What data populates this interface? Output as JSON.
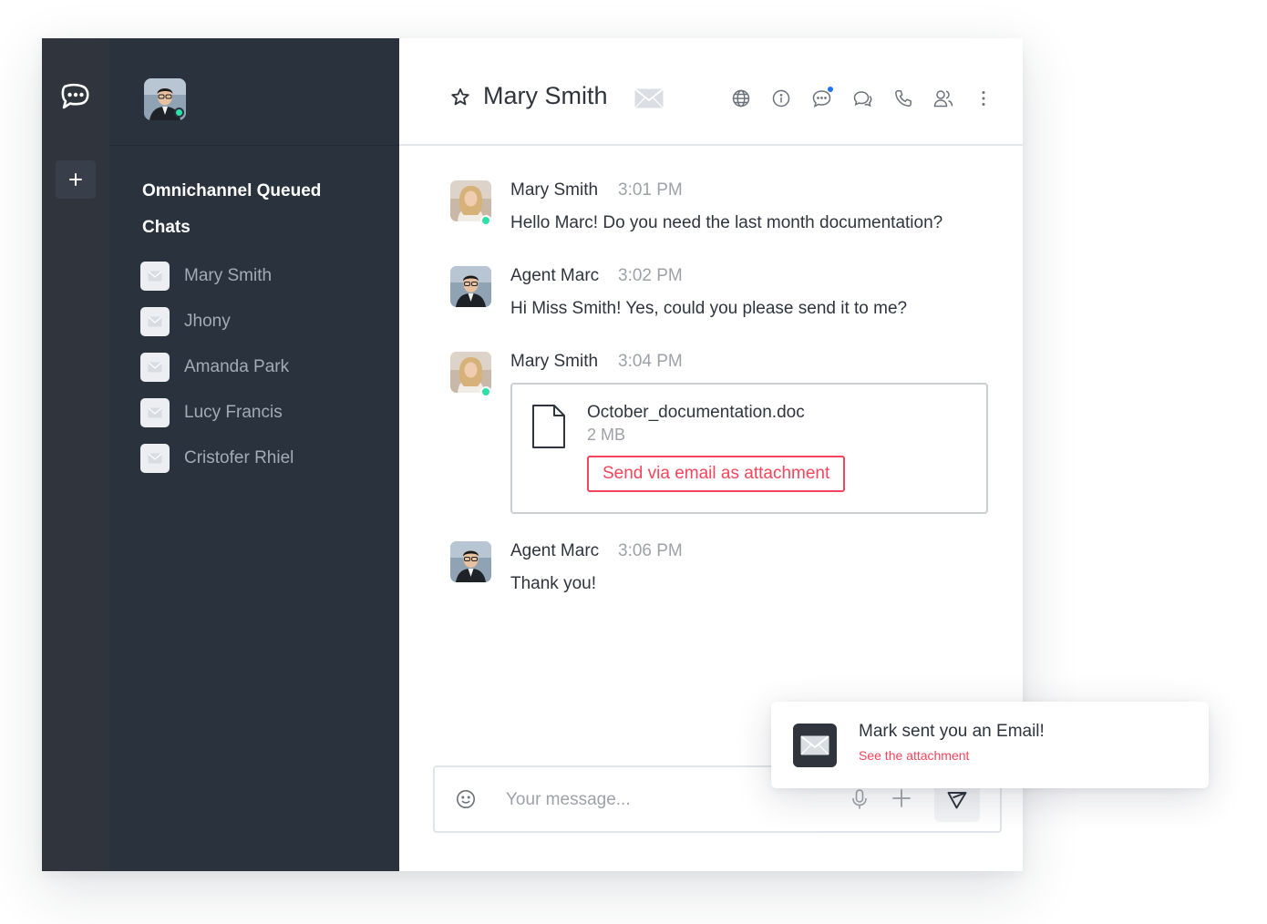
{
  "sidebar": {
    "section_title": "Omnichannel Queued Chats",
    "rooms": [
      {
        "label": "Mary Smith",
        "icon": "envelope-icon"
      },
      {
        "label": "Jhony",
        "icon": "envelope-icon"
      },
      {
        "label": "Amanda Park",
        "icon": "envelope-icon"
      },
      {
        "label": "Lucy Francis",
        "icon": "envelope-icon"
      },
      {
        "label": "Cristofer Rhiel",
        "icon": "envelope-icon"
      }
    ]
  },
  "header": {
    "title": "Mary Smith",
    "icons": [
      "star-icon",
      "envelope-icon",
      "globe-icon",
      "info-icon",
      "discussion-icon",
      "threads-icon",
      "phone-icon",
      "members-icon",
      "kebab-icon"
    ]
  },
  "messages": [
    {
      "author": "Mary Smith",
      "time": "3:01 PM",
      "text": "Hello Marc! Do you need the last month documentation?"
    },
    {
      "author": "Agent Marc",
      "time": "3:02 PM",
      "text": "Hi Miss Smith! Yes, could you please send it to me?"
    },
    {
      "author": "Mary Smith",
      "time": "3:04 PM",
      "attachment": {
        "name": "October_documentation.doc",
        "size": "2 MB",
        "action": "Send via email as attachment"
      }
    },
    {
      "author": "Agent Marc",
      "time": "3:06 PM",
      "text": "Thank you!"
    }
  ],
  "composer": {
    "placeholder": "Your message..."
  },
  "toast": {
    "title": "Mark sent you an Email!",
    "link": "See the attachment"
  },
  "colors": {
    "rail_bg": "#2f343d",
    "sidebar_bg": "#29323d",
    "accent_red": "#f5455c",
    "online_green": "#2de0a5",
    "notify_blue": "#1d74f5"
  }
}
